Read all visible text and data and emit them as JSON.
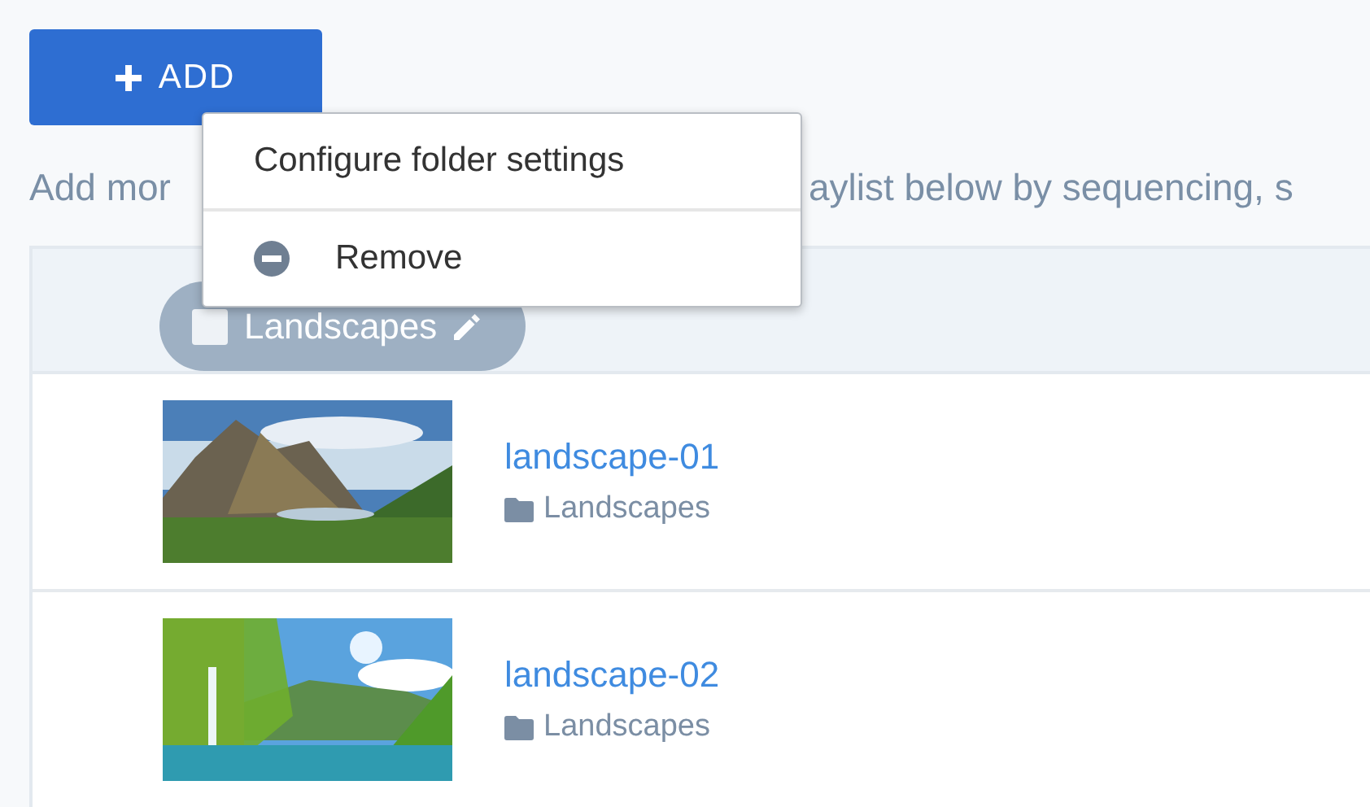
{
  "add_button": {
    "label": "ADD"
  },
  "description": {
    "visible_parts": [
      "Add mor",
      "aylist below by sequencing, s"
    ]
  },
  "folder_header": {
    "chip": {
      "label": "Landscapes",
      "disabled": true
    }
  },
  "rows": [
    {
      "title": "landscape-01",
      "folder": "Landscapes"
    },
    {
      "title": "landscape-02",
      "folder": "Landscapes"
    }
  ],
  "context_menu": {
    "items": [
      {
        "label": "Configure folder settings",
        "kind": "plain"
      },
      {
        "label": "Remove",
        "kind": "remove"
      }
    ]
  }
}
